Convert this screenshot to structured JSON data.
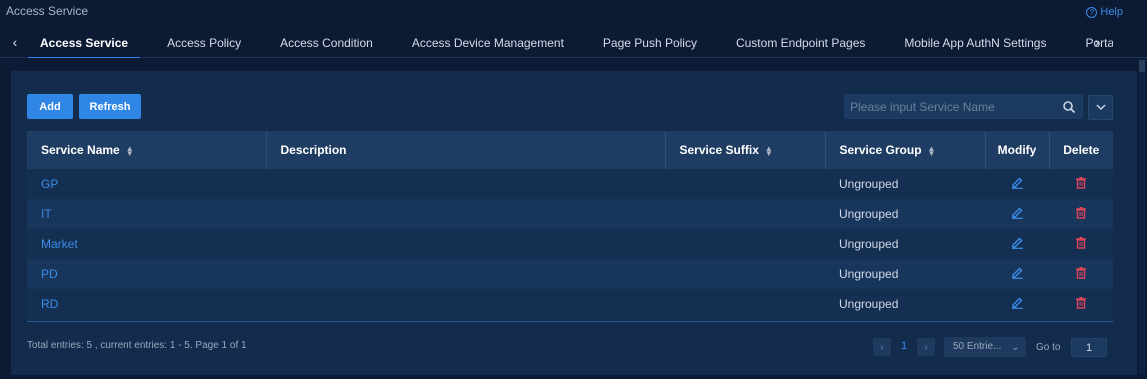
{
  "app": {
    "title": "Access Service",
    "help_label": "Help"
  },
  "tabs": [
    {
      "label": "Access Service",
      "active": true
    },
    {
      "label": "Access Policy"
    },
    {
      "label": "Access Condition"
    },
    {
      "label": "Access Device Management"
    },
    {
      "label": "Page Push Policy"
    },
    {
      "label": "Custom Endpoint Pages"
    },
    {
      "label": "Mobile App AuthN Settings"
    },
    {
      "label": "Portal Ma"
    }
  ],
  "toolbar": {
    "add_label": "Add",
    "refresh_label": "Refresh",
    "search_placeholder": "Please input Service Name"
  },
  "table": {
    "headers": {
      "service_name": "Service Name",
      "description": "Description",
      "service_suffix": "Service Suffix",
      "service_group": "Service Group",
      "modify": "Modify",
      "delete": "Delete"
    },
    "rows": [
      {
        "name": "GP",
        "description": "",
        "suffix": "",
        "group": "Ungrouped"
      },
      {
        "name": "IT",
        "description": "",
        "suffix": "",
        "group": "Ungrouped"
      },
      {
        "name": "Market",
        "description": "",
        "suffix": "",
        "group": "Ungrouped"
      },
      {
        "name": "PD",
        "description": "",
        "suffix": "",
        "group": "Ungrouped"
      },
      {
        "name": "RD",
        "description": "",
        "suffix": "",
        "group": "Ungrouped"
      }
    ]
  },
  "footer": {
    "summary": "Total entries: 5 , current entries: 1 - 5. Page 1 of 1",
    "current_page": "1",
    "entries_per_page": "50 Entrie...",
    "goto_label": "Go to",
    "goto_value": "1"
  },
  "colors": {
    "accent": "#2f86e4",
    "link": "#3b8de8",
    "delete": "#e0455a"
  }
}
